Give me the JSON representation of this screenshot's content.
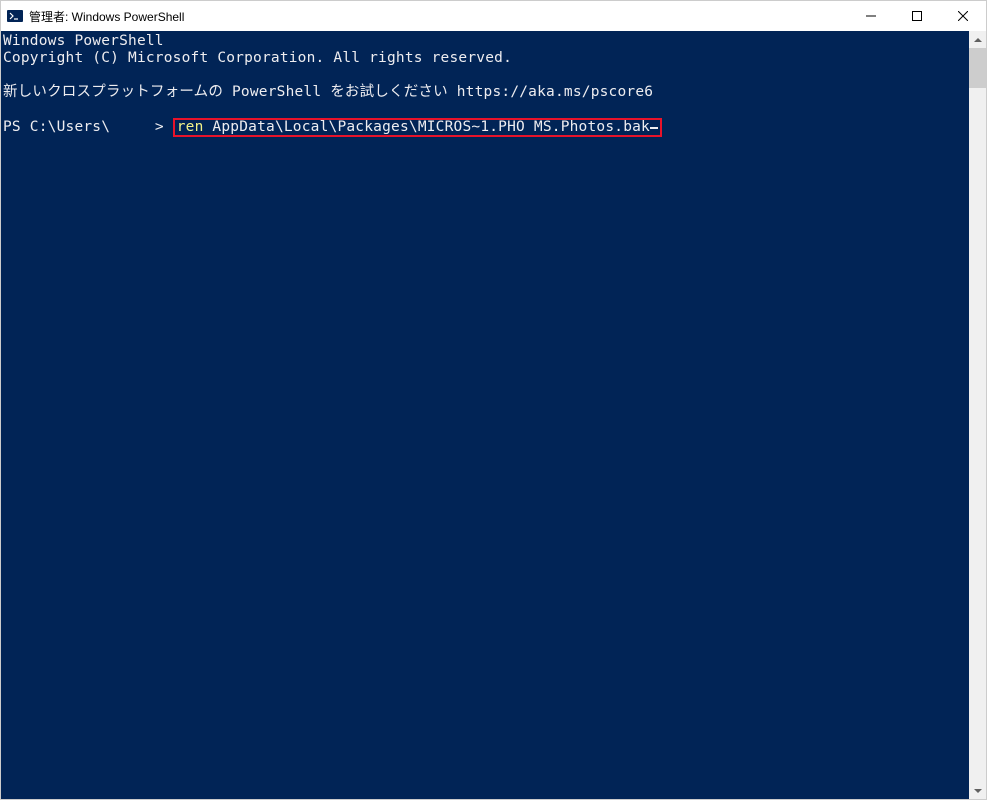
{
  "window": {
    "title": "管理者: Windows PowerShell"
  },
  "terminal": {
    "line1": "Windows PowerShell",
    "line2": "Copyright (C) Microsoft Corporation. All rights reserved.",
    "line3": "新しいクロスプラットフォームの PowerShell をお試しください https://aka.ms/pscore6",
    "prompt_prefix": "PS C:\\Users\\",
    "prompt_user_hidden": "     ",
    "prompt_suffix": "> ",
    "cmd_keyword": "ren",
    "cmd_args": " AppData\\Local\\Packages\\MICROS~1.PHO MS.Photos.bak"
  },
  "controls": {
    "minimize": "—",
    "maximize": "☐",
    "close": "✕"
  }
}
